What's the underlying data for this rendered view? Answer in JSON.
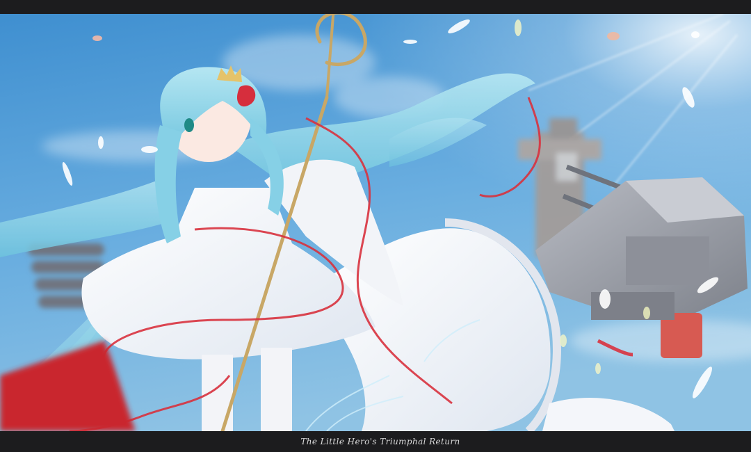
{
  "caption": {
    "text": "The Little Hero's Triumphal Return"
  },
  "scene": {
    "sky_top_color": "#3f8fd0",
    "sky_bottom_color": "#8fc3e4",
    "hair_color": "#9fdcec",
    "dress_color": "#f7f8fb",
    "ribbon_color": "#d8323e",
    "turret_color": "#9c9fa8"
  }
}
